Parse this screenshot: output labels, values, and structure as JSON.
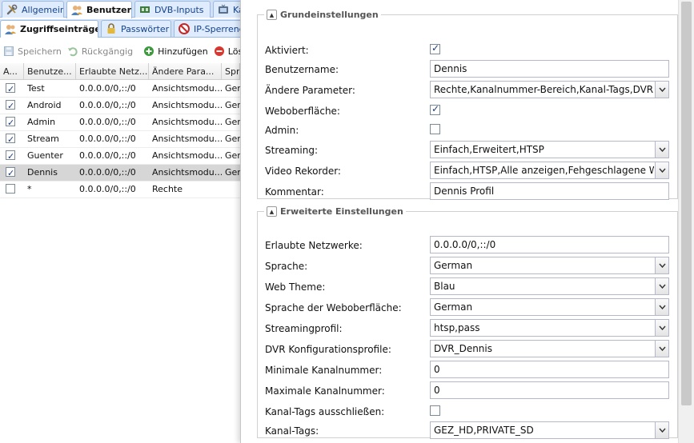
{
  "colors": {
    "tab_bg": "#d2e0f2",
    "tab_border": "#99bbe8",
    "selected_row": "#d6d6d6",
    "field_border": "#b5b8c8"
  },
  "main_tabs": [
    {
      "label": "Allgemein",
      "icon": "wrench-icon"
    },
    {
      "label": "Benutzer",
      "icon": "users-icon"
    },
    {
      "label": "DVB-Inputs",
      "icon": "dvb-card-icon"
    },
    {
      "label": "Ka",
      "icon": "tv-icon"
    }
  ],
  "sub_tabs": [
    {
      "label": "Zugriffseinträge",
      "icon": "users-icon"
    },
    {
      "label": "Passwörter",
      "icon": "lock-icon"
    },
    {
      "label": "IP-Sperrene",
      "icon": "no-entry-icon"
    }
  ],
  "toolbar": {
    "save": "Speichern",
    "undo": "Rückgängig",
    "add": "Hinzufügen",
    "delete": "Lösche"
  },
  "grid": {
    "columns": [
      "A...",
      "Benutze...",
      "Erlaubte Netz...",
      "Ändere Para...",
      "Spr"
    ],
    "rows": [
      {
        "enabled": true,
        "name": "Test",
        "network": "0.0.0.0/0,::/0",
        "params": "Ansichtsmodu...",
        "lang": "Ger"
      },
      {
        "enabled": true,
        "name": "Android",
        "network": "0.0.0.0/0,::/0",
        "params": "Ansichtsmodu...",
        "lang": "Ger"
      },
      {
        "enabled": true,
        "name": "Admin",
        "network": "0.0.0.0/0,::/0",
        "params": "Ansichtsmodu...",
        "lang": "Ger"
      },
      {
        "enabled": true,
        "name": "Stream",
        "network": "0.0.0.0/0,::/0",
        "params": "Ansichtsmodu...",
        "lang": "Ger"
      },
      {
        "enabled": true,
        "name": "Guenter",
        "network": "0.0.0.0/0,::/0",
        "params": "Ansichtsmodu...",
        "lang": "Ger"
      },
      {
        "enabled": true,
        "name": "Dennis",
        "network": "0.0.0.0/0,::/0",
        "params": "Ansichtsmodu...",
        "lang": "Ger",
        "selected": true
      },
      {
        "enabled": false,
        "name": "*",
        "network": "0.0.0.0/0,::/0",
        "params": "Rechte",
        "lang": ""
      }
    ]
  },
  "basic": {
    "legend": "Grundeinstellungen",
    "enabled_label": "Aktiviert:",
    "enabled": true,
    "username_label": "Benutzername:",
    "username": "Dennis",
    "params_label": "Ändere Parameter:",
    "params": "Rechte,Kanalnummer-Bereich,Kanal-Tags,DVR Konfi",
    "webui_label": "Weboberfläche:",
    "webui": true,
    "admin_label": "Admin:",
    "admin": false,
    "streaming_label": "Streaming:",
    "streaming": "Einfach,Erweitert,HTSP",
    "recorder_label": "Video Rekorder:",
    "recorder": "Einfach,HTSP,Alle anzeigen,Fehgeschlagene Wieder",
    "comment_label": "Kommentar:",
    "comment": "Dennis Profil"
  },
  "advanced": {
    "legend": "Erweiterte Einstellungen",
    "networks_label": "Erlaubte Netzwerke:",
    "networks": "0.0.0.0/0,::/0",
    "language_label": "Sprache:",
    "language": "German",
    "theme_label": "Web Theme:",
    "theme": "Blau",
    "ui_language_label": "Sprache der Weboberfläche:",
    "ui_language": "German",
    "stream_profile_label": "Streamingprofil:",
    "stream_profile": "htsp,pass",
    "dvr_profile_label": "DVR Konfigurationsprofile:",
    "dvr_profile": "DVR_Dennis",
    "min_channel_label": "Minimale Kanalnummer:",
    "min_channel": "0",
    "max_channel_label": "Maximale Kanalnummer:",
    "max_channel": "0",
    "exclude_tags_label": "Kanal-Tags ausschließen:",
    "exclude_tags": false,
    "channel_tags_label": "Kanal-Tags:",
    "channel_tags": "GEZ_HD,PRIVATE_SD"
  }
}
